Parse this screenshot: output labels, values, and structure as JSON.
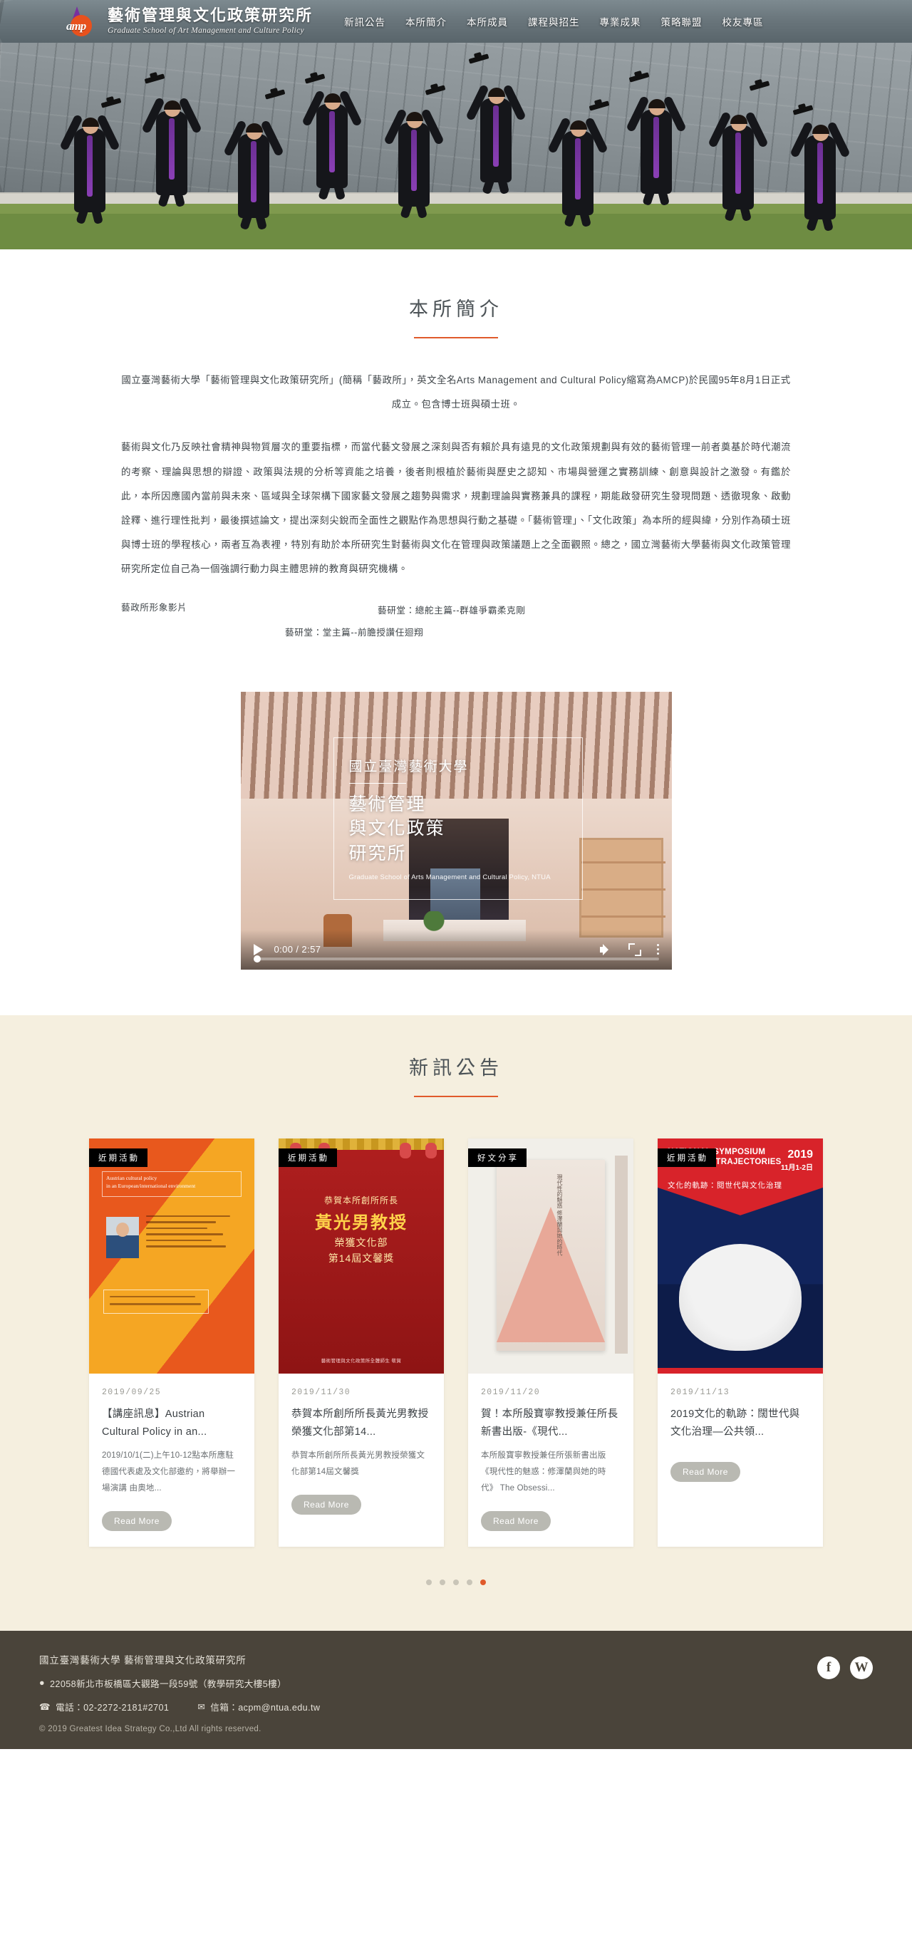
{
  "site": {
    "brand_cn": "藝術管理與文化政策研究所",
    "brand_en": "Graduate School of Art Management and Culture Policy",
    "logo_text": "amp"
  },
  "nav": {
    "items": [
      {
        "label": "新訊公告"
      },
      {
        "label": "本所簡介"
      },
      {
        "label": "本所成員"
      },
      {
        "label": "課程與招生"
      },
      {
        "label": "專業成果"
      },
      {
        "label": "策略聯盟"
      },
      {
        "label": "校友專區"
      }
    ]
  },
  "intro": {
    "title": "本所簡介",
    "paragraphs": [
      "國立臺灣藝術大學「藝術管理與文化政策研究所」(簡稱「藝政所」，英文全名Arts Management and Cultural Policy縮寫為AMCP)於民國95年8月1日正式成立。包含博士班與碩士班。",
      "藝術與文化乃反映社會精神與物質層次的重要指標，而當代藝文發展之深刻與否有賴於具有遠見的文化政策規劃與有效的藝術管理一前者奠基於時代潮流的考察、理論與思想的辯證、政策與法規的分析等資能之培養，後者則根植於藝術與歷史之認知、市場與營運之實務訓練、創意與設計之激發。有鑑於此，本所因應國內當前與未來、區域與全球架構下國家藝文發展之趨勢與需求，規劃理論與實務兼具的課程，期能啟發研究生發現問題、透徹現象、啟動詮釋、進行理性批判，最後撰述論文，提出深刻尖銳而全面性之觀點作為思想與行動之基礎。「藝術管理」、「文化政策」為本所的經與緯，分別作為碩士班與博士班的學程核心，兩者互為表裡，特別有助於本所研究生對藝術與文化在管理與政策議題上之全面觀照。總之，國立灣藝術大學藝術與文化政策管理研究所定位自己為一個強調行動力與主體思辨的教育與研究機構。"
    ],
    "links": {
      "video_label": "藝政所形象影片",
      "link1": "藝研堂：總舵主篇--群雄爭霸柔克剛",
      "link2": "藝研堂：堂主篇--前膽授讚任迴翔"
    }
  },
  "video": {
    "title_line1": "國立臺灣藝術大學",
    "title_line2": "藝術管理\n與文化政策\n研究所",
    "subtitle": "Graduate School of Arts Management and Cultural Policy, NTUA",
    "time": "0:00 / 2:57",
    "play_icon": "play-icon",
    "volume_icon": "volume-icon",
    "fullscreen_icon": "fullscreen-icon",
    "more_icon": "more-options-icon"
  },
  "news": {
    "title": "新訊公告",
    "read_more_label": "Read More",
    "cards": [
      {
        "badge": "近期活動",
        "date": "2019/09/25",
        "title": "【講座訊息】Austrian Cultural Policy in an...",
        "desc": "2019/10/1(二)上午10-12點本所應駐德國代表處及文化部邀約，將舉辦一場演講 由奧地...",
        "poster": {
          "headline1": "Austrian cultural policy",
          "headline2": "in an European/international environment"
        }
      },
      {
        "badge": "近期活動",
        "date": "2019/11/30",
        "title": "恭賀本所創所所長黃光男教授 榮獲文化部第14...",
        "desc": "恭賀本所創所所長黃光男教授榮獲文化部第14屆文馨獎",
        "poster": {
          "line1": "恭賀本所創所所長",
          "line2": "黃光男教授",
          "line3": "榮獲文化部\n第14屆文馨獎",
          "line4": "藝術管理與文化政策所全體師生 敬賀"
        }
      },
      {
        "badge": "好文分享",
        "date": "2019/11/20",
        "title": "賀！本所殷寶寧教授兼任所長新書出版-《現代...",
        "desc": "本所殷寶寧教授兼任所張新書出版 《現代性的魅惑：修澤蘭與她的時代》 The Obsessi...",
        "poster": {
          "vertical": "現代性的魅惑 修澤蘭與她的時代"
        }
      },
      {
        "badge": "近期活動",
        "date": "2019/11/13",
        "title": "2019文化的軌跡：闊世代與文化治理—公共領...",
        "desc": "",
        "poster": {
          "en": "NATIONAL SYMPOSIUM\nCULTURAL TRAJECTORIES",
          "cn": "文化的軌跡：閱世代與文化治理",
          "year": "2019",
          "date": "11月1-2日"
        }
      }
    ],
    "dots": [
      false,
      false,
      false,
      false,
      true
    ]
  },
  "footer": {
    "org": "國立臺灣藝術大學 藝術管理與文化政策研究所",
    "address": "22058新北市板橋區大觀路一段59號（教學研究大樓5樓）",
    "phone": "電話：02-2272-2181#2701",
    "email": "信箱：acpm@ntua.edu.tw",
    "copyright": "© 2019 Greatest Idea Strategy Co.,Ltd All rights reserved.",
    "social": [
      {
        "name": "facebook-icon",
        "glyph": "f"
      },
      {
        "name": "wordpress-icon",
        "glyph": "W"
      }
    ]
  },
  "colors": {
    "accent": "#e05a2b",
    "news_bg": "#f5efdf",
    "footer_bg": "#4a443a"
  }
}
